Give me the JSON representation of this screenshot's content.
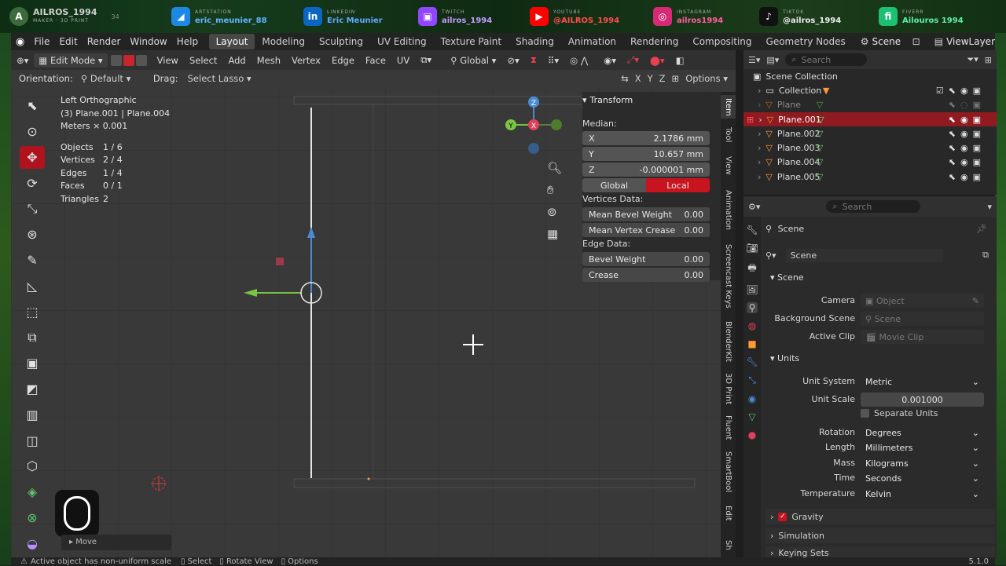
{
  "social": {
    "brand": "AILROS_1994",
    "brand_sub": "MAKER · 3D PRINT",
    "badge": "34",
    "items": [
      {
        "label": "ARTSTATION",
        "handle": "eric_meunier_88",
        "color": "#1e88e5",
        "glyph": "◢"
      },
      {
        "label": "LINKEDIN",
        "handle": "Eric Meunier",
        "color": "#0a66c2",
        "glyph": "in"
      },
      {
        "label": "TWITCH",
        "handle": "ailros_1994",
        "color": "#9146ff",
        "glyph": "▣"
      },
      {
        "label": "YOUTUBE",
        "handle": "@AILROS_1994",
        "color": "#ff0000",
        "glyph": "▶"
      },
      {
        "label": "INSTAGRAM",
        "handle": "ailros1994",
        "color": "#d62976",
        "glyph": "◎"
      },
      {
        "label": "TIKTOK",
        "handle": "@ailros_1994",
        "color": "#111111",
        "glyph": "♪"
      },
      {
        "label": "FIVERR",
        "handle": "Ailouros 1994",
        "color": "#1dbf73",
        "glyph": "fi"
      }
    ]
  },
  "menubar": {
    "menus": [
      "File",
      "Edit",
      "Render",
      "Window",
      "Help"
    ],
    "workspaces": [
      "Layout",
      "Modeling",
      "Sculpting",
      "UV Editing",
      "Texture Paint",
      "Shading",
      "Animation",
      "Rendering",
      "Compositing",
      "Geometry Nodes"
    ],
    "active_workspace": "Layout",
    "scene": "Scene",
    "view_layer": "ViewLayer"
  },
  "viewport": {
    "mode": "Edit Mode",
    "menus": [
      "View",
      "Select",
      "Add",
      "Mesh",
      "Vertex",
      "Edge",
      "Face",
      "UV"
    ],
    "transform_space": "Global",
    "options": "Options",
    "orientation_label": "Orientation:",
    "orientation": "Default",
    "drag_label": "Drag:",
    "drag": "Select Lasso",
    "axes": [
      "X",
      "Y",
      "Z"
    ],
    "view_name": "Left Orthographic",
    "object_line": "(3) Plane.001 | Plane.004",
    "scale_line": "Meters × 0.001",
    "stats": [
      [
        "Objects",
        "1 / 6"
      ],
      [
        "Vertices",
        "2 / 4"
      ],
      [
        "Edges",
        "1 / 4"
      ],
      [
        "Faces",
        "0 / 1"
      ],
      [
        "Triangles",
        "2"
      ]
    ],
    "last_op": "Move"
  },
  "npanel": {
    "title": "Transform",
    "median": "Median:",
    "x_label": "X",
    "x": "2.1786 mm",
    "y_label": "Y",
    "y": "10.657 mm",
    "z_label": "Z",
    "z": "-0.000001 mm",
    "global": "Global",
    "local": "Local",
    "vertices_data": "Vertices Data:",
    "bevel_w": "Mean Bevel Weight",
    "bevel_w_val": "0.00",
    "crease": "Mean Vertex Crease",
    "crease_val": "0.00",
    "edge_data": "Edge Data:",
    "edge_bevel": "Bevel Weight",
    "edge_bevel_val": "0.00",
    "edge_crease": "Crease",
    "edge_crease_val": "0.00",
    "tabs": [
      "Item",
      "Tool",
      "View",
      "Animation",
      "Screencast Keys",
      "BlenderKit",
      "3D Print",
      "Fluent",
      "SmartBool",
      "Edit",
      "Sh"
    ]
  },
  "outliner": {
    "search": "Search",
    "root": "Scene Collection",
    "items": [
      "Collection",
      "Plane",
      "Plane.001",
      "Plane.002",
      "Plane.003",
      "Plane.004",
      "Plane.005"
    ]
  },
  "properties": {
    "search": "Search",
    "header": "Scene",
    "scene_field": "Scene",
    "section_scene": "Scene",
    "camera_label": "Camera",
    "camera": "Object",
    "bg_label": "Background Scene",
    "bg": "Scene",
    "clip_label": "Active Clip",
    "clip": "Movie Clip",
    "section_units": "Units",
    "unit_system_label": "Unit System",
    "unit_system": "Metric",
    "unit_scale_label": "Unit Scale",
    "unit_scale": "0.001000",
    "separate_units": "Separate Units",
    "rotation_label": "Rotation",
    "rotation": "Degrees",
    "length_label": "Length",
    "length": "Millimeters",
    "mass_label": "Mass",
    "mass": "Kilograms",
    "time_label": "Time",
    "time": "Seconds",
    "temp_label": "Temperature",
    "temp": "Kelvin",
    "gravity": "Gravity",
    "simulation": "Simulation",
    "keying": "Keying Sets"
  },
  "status": {
    "message": "Active object has non-uniform scale",
    "select": "Select",
    "rotate": "Rotate View",
    "options": "Options",
    "version": "5.1.0"
  }
}
